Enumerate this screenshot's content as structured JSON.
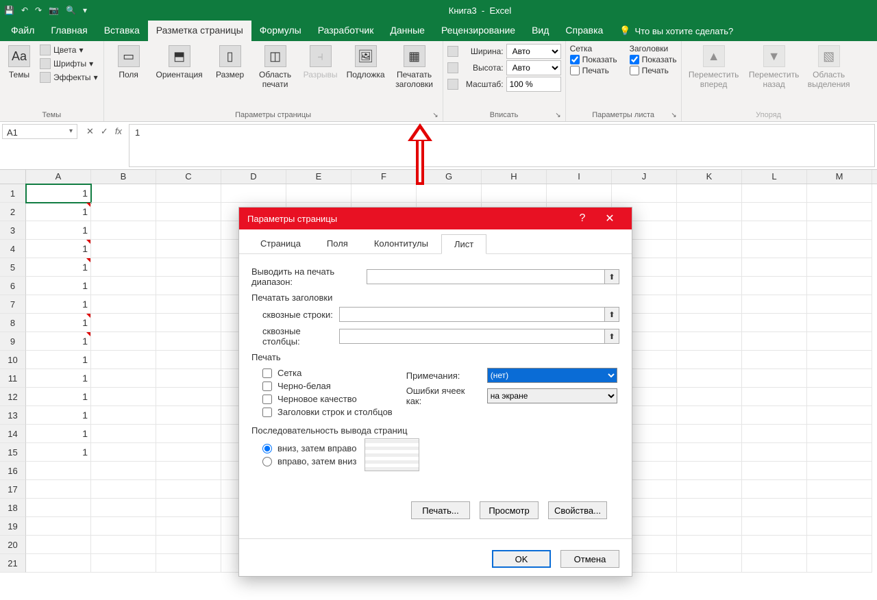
{
  "titlebar": {
    "doc": "Книга3",
    "app": "Excel"
  },
  "tabs": {
    "file": "Файл",
    "home": "Главная",
    "insert": "Вставка",
    "layout": "Разметка страницы",
    "formulas": "Формулы",
    "developer": "Разработчик",
    "data": "Данные",
    "review": "Рецензирование",
    "view": "Вид",
    "help": "Справка",
    "tell": "Что вы хотите сделать?"
  },
  "ribbon": {
    "themes": {
      "group": "Темы",
      "themes_btn": "Темы",
      "colors": "Цвета",
      "fonts": "Шрифты",
      "effects": "Эффекты"
    },
    "page_setup": {
      "group": "Параметры страницы",
      "margins": "Поля",
      "orientation": "Ориентация",
      "size": "Размер",
      "print_area": "Область печати",
      "breaks": "Разрывы",
      "background": "Подложка",
      "print_titles": "Печатать заголовки"
    },
    "scale": {
      "group": "Вписать",
      "width_lbl": "Ширина:",
      "width_val": "Авто",
      "height_lbl": "Высота:",
      "height_val": "Авто",
      "scale_lbl": "Масштаб:",
      "scale_val": "100 %"
    },
    "sheet": {
      "group": "Параметры листа",
      "grid_lbl": "Сетка",
      "head_lbl": "Заголовки",
      "show": "Показать",
      "print": "Печать"
    },
    "arrange": {
      "group": "Упоряд",
      "forward": "Переместить вперед",
      "backward": "Переместить назад",
      "select": "Область выделения"
    }
  },
  "fbar": {
    "name": "A1",
    "fx": "fx",
    "value": "1"
  },
  "columns": [
    "A",
    "B",
    "C",
    "D",
    "E",
    "F",
    "G",
    "H",
    "I",
    "J",
    "K",
    "L",
    "M"
  ],
  "rows": [
    {
      "n": 1,
      "a": "1",
      "cmt": false,
      "sel": true
    },
    {
      "n": 2,
      "a": "1",
      "cmt": true
    },
    {
      "n": 3,
      "a": "1"
    },
    {
      "n": 4,
      "a": "1",
      "cmt": true
    },
    {
      "n": 5,
      "a": "1",
      "cmt": true
    },
    {
      "n": 6,
      "a": "1"
    },
    {
      "n": 7,
      "a": "1"
    },
    {
      "n": 8,
      "a": "1",
      "cmt": true
    },
    {
      "n": 9,
      "a": "1",
      "cmt": true
    },
    {
      "n": 10,
      "a": "1"
    },
    {
      "n": 11,
      "a": "1"
    },
    {
      "n": 12,
      "a": "1"
    },
    {
      "n": 13,
      "a": "1"
    },
    {
      "n": 14,
      "a": "1"
    },
    {
      "n": 15,
      "a": "1"
    },
    {
      "n": 16,
      "a": ""
    },
    {
      "n": 17,
      "a": ""
    },
    {
      "n": 18,
      "a": ""
    },
    {
      "n": 19,
      "a": ""
    },
    {
      "n": 20,
      "a": ""
    },
    {
      "n": 21,
      "a": ""
    }
  ],
  "dialog": {
    "title": "Параметры страницы",
    "tabs": {
      "page": "Страница",
      "margins": "Поля",
      "hf": "Колонтитулы",
      "sheet": "Лист"
    },
    "print_range_lbl": "Выводить на печать диапазон:",
    "print_titles_section": "Печатать заголовки",
    "rows_repeat_lbl": "сквозные строки:",
    "cols_repeat_lbl": "сквозные столбцы:",
    "print_section": "Печать",
    "chk_grid": "Сетка",
    "chk_bw": "Черно-белая",
    "chk_draft": "Черновое качество",
    "chk_rowcol": "Заголовки строк и столбцов",
    "notes_lbl": "Примечания:",
    "notes_val": "(нет)",
    "errors_lbl": "Ошибки ячеек как:",
    "errors_val": "на экране",
    "order_section": "Последовательность вывода страниц",
    "order_down": "вниз, затем вправо",
    "order_over": "вправо, затем вниз",
    "btn_print": "Печать...",
    "btn_preview": "Просмотр",
    "btn_props": "Свойства...",
    "btn_ok": "OK",
    "btn_cancel": "Отмена"
  }
}
